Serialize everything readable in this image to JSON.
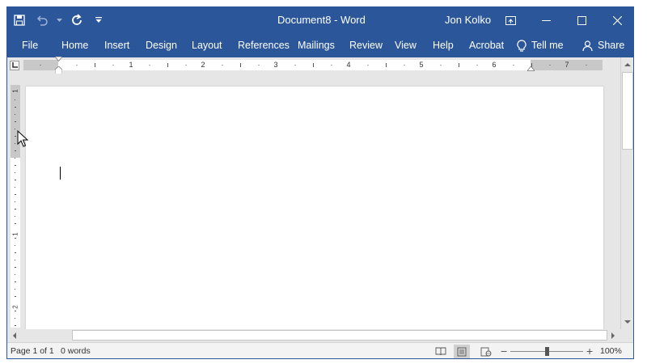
{
  "title_bar": {
    "document_title": "Document8  -  Word",
    "user_name": "Jon Kolko",
    "quick_access": [
      "save-icon",
      "undo-icon",
      "redo-icon",
      "customize-qat-icon"
    ],
    "window_controls": [
      "ribbon-display-options-icon",
      "minimize-icon",
      "maximize-icon",
      "close-icon"
    ]
  },
  "ribbon": {
    "tabs": [
      "File",
      "Home",
      "Insert",
      "Design",
      "Layout",
      "References",
      "Mailings",
      "Review",
      "View",
      "Help",
      "Acrobat"
    ],
    "tell_me": "Tell me",
    "share": "Share"
  },
  "ruler": {
    "horizontal_numbers": [
      "1",
      "2",
      "3",
      "4",
      "5",
      "6",
      "7"
    ],
    "vertical_numbers": [
      "1",
      "1",
      "2"
    ]
  },
  "status_bar": {
    "page": "Page 1 of 1",
    "words": "0 words",
    "zoom": "100%",
    "zoom_level": 1.0,
    "view_modes": [
      "read-mode-icon",
      "print-layout-icon",
      "web-layout-icon"
    ],
    "active_view": "print-layout-icon"
  },
  "colors": {
    "title_bar": "#2b579a",
    "background": "#e6e6e6",
    "page": "#ffffff"
  }
}
